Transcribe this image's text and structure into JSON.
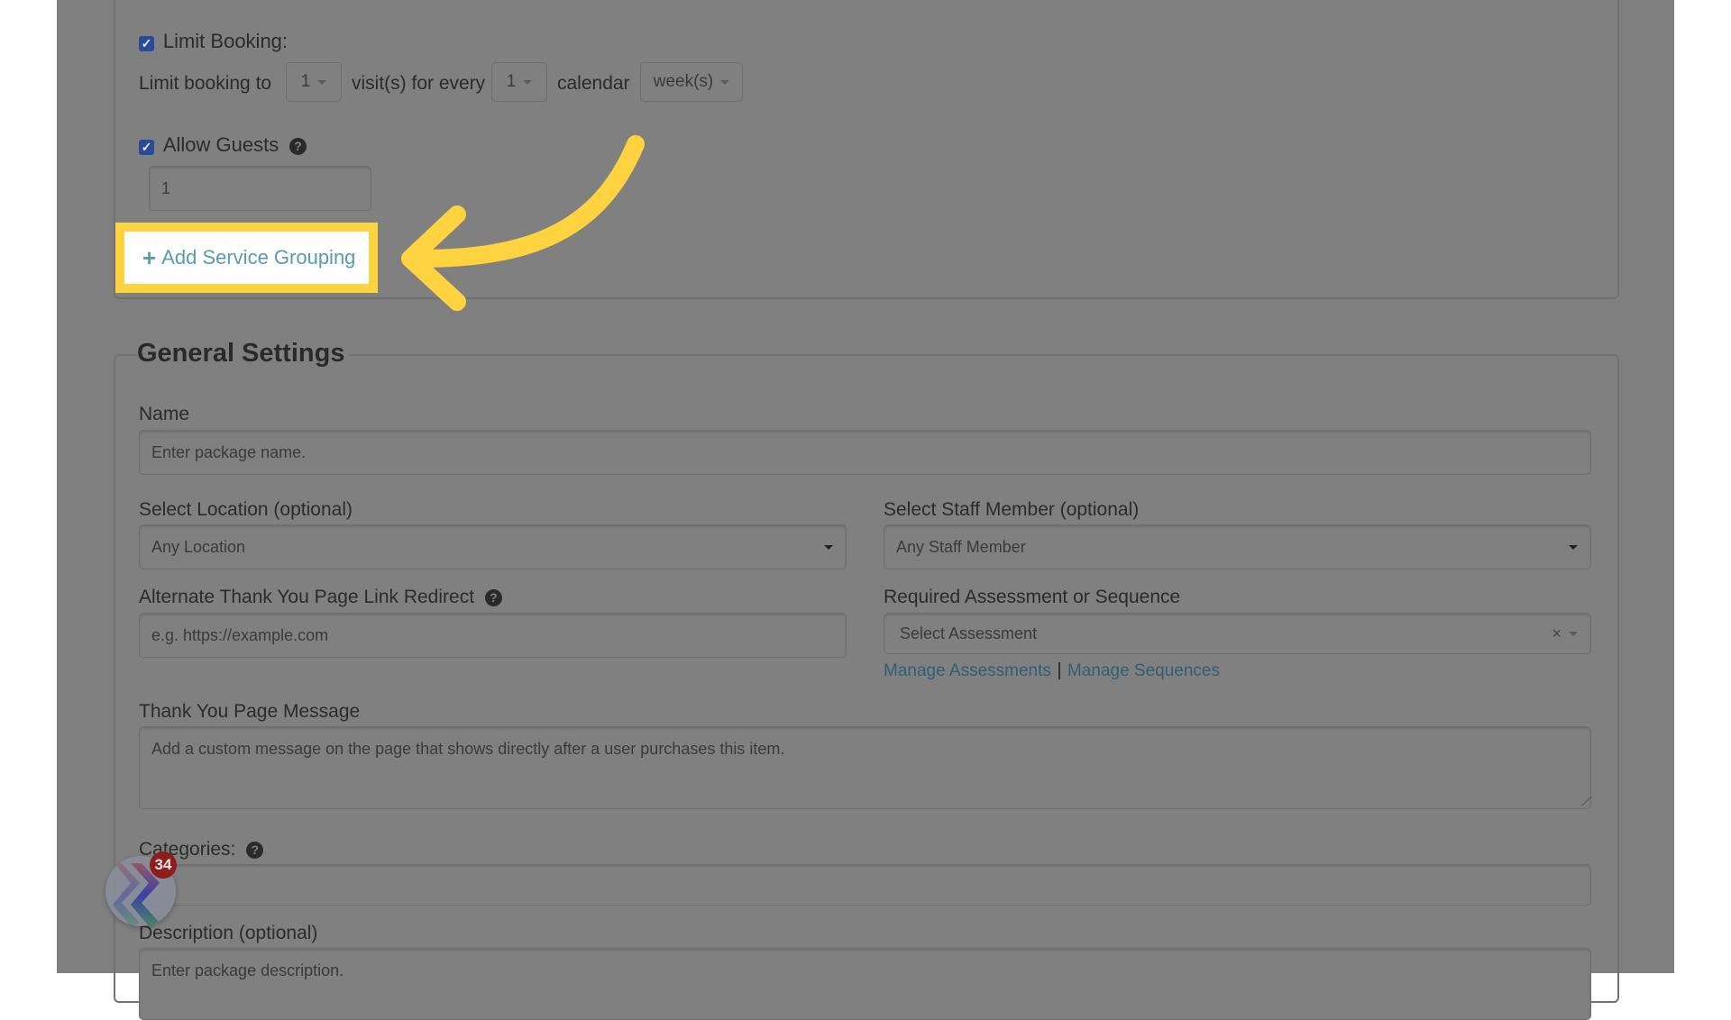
{
  "limit_booking": {
    "checkbox_label": "Limit Booking:",
    "checked": true,
    "prefix": "Limit booking to",
    "visits_value": "1",
    "middle": "visit(s) for every",
    "period_count_value": "1",
    "calendar_label": "calendar",
    "period_unit_value": "week(s)"
  },
  "allow_guests": {
    "checkbox_label": "Allow Guests",
    "checked": true,
    "help_icon": "question-circle-icon",
    "value": "1"
  },
  "add_service_grouping": {
    "icon": "plus-icon",
    "label": "Add Service Grouping"
  },
  "annotation": {
    "highlight_color": "#ffd23f",
    "arrow_color": "#ffd23f"
  },
  "general_settings": {
    "title": "General Settings",
    "name": {
      "label": "Name",
      "placeholder": "Enter package name."
    },
    "location": {
      "label": "Select Location (optional)",
      "value": "Any Location"
    },
    "staff": {
      "label": "Select Staff Member (optional)",
      "value": "Any Staff Member"
    },
    "redirect": {
      "label": "Alternate Thank You Page Link Redirect",
      "placeholder": "e.g. https://example.com"
    },
    "assessment": {
      "label": "Required Assessment or Sequence",
      "value": "Select Assessment",
      "clear_glyph": "×",
      "manage_assessments": "Manage Assessments",
      "separator": "|",
      "manage_sequences": "Manage Sequences"
    },
    "thank_you": {
      "label": "Thank You Page Message",
      "placeholder": "Add a custom message on the page that shows directly after a user purchases this item."
    },
    "categories": {
      "label": "Categories:",
      "value": ""
    },
    "description": {
      "label": "Description (optional)",
      "placeholder": "Enter package description."
    }
  },
  "widget": {
    "icon": "chat-widget-icon",
    "badge_count": "34"
  },
  "colors": {
    "overlay_gray": "#808080",
    "link": "#2f5f72",
    "checkbox": "#2a4a9a",
    "badge": "#8f1d1d"
  }
}
